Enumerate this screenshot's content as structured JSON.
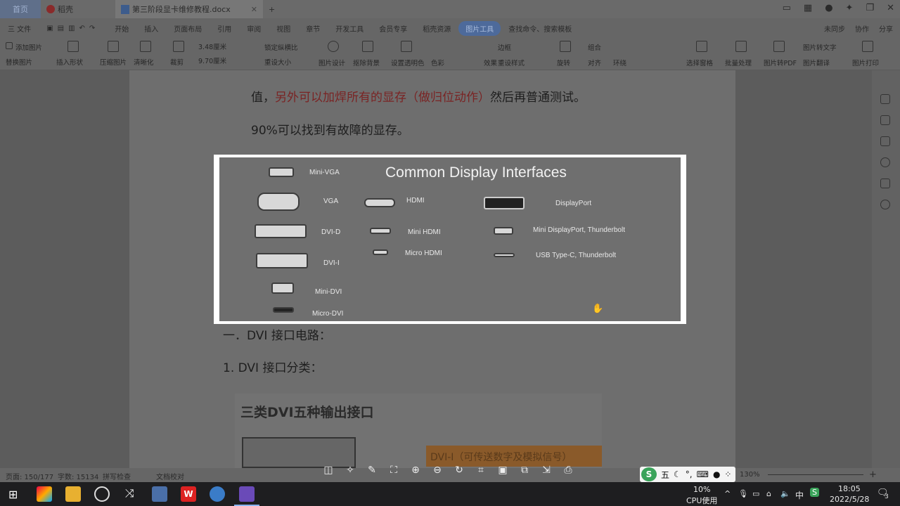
{
  "titlebar": {
    "home_tab": "首页",
    "tab_wps": "稻壳",
    "tab_doc": "第三阶段显卡维修教程.docx",
    "new_tab": "+"
  },
  "menu": {
    "items": [
      "三 文件",
      "开始",
      "插入",
      "页面布局",
      "引用",
      "审阅",
      "视图",
      "章节",
      "开发工具",
      "会员专享",
      "稻壳资源"
    ],
    "selected": "图片工具",
    "search": "查找命令、搜索模板",
    "right": [
      "未同步",
      "协作",
      "分享"
    ]
  },
  "ribbon": {
    "row1": [
      "添加图片",
      "3.48厘米",
      "锁定纵横比",
      "边框",
      "组合",
      "图片转文字"
    ],
    "row2": [
      "替换图片",
      "插入形状",
      "压缩图片",
      "清晰化",
      "裁剪",
      "9.70厘米",
      "重设大小",
      "图片设计",
      "抠除背景",
      "设置透明色",
      "色彩",
      "效果",
      "重设样式",
      "旋转",
      "对齐",
      "环绕",
      "选择窗格",
      "批量处理",
      "图片转PDF",
      "图片翻译",
      "图片打印"
    ]
  },
  "doc": {
    "line1_prefix": "值，",
    "line1_red": "另外可以加焊所有的显存（做归位动作）",
    "line1_suffix": "然后再普通测试。",
    "line2": "90%可以找到有故障的显存。",
    "heading1": "一．DVI 接口电路：",
    "heading2": "1.  DVI 接口分类：",
    "pic_title": "三类DVI五种输出接口",
    "pic_label": "DVI-I（可传送数字及模拟信号）"
  },
  "viewer": {
    "title": "Common Display Interfaces",
    "labels": {
      "mini_vga": "Mini-VGA",
      "vga": "VGA",
      "dvi_d": "DVI-D",
      "dvi_i": "DVI-I",
      "mini_dvi": "Mini-DVI",
      "micro_dvi": "Micro-DVI",
      "hdmi": "HDMI",
      "mini_hdmi": "Mini HDMI",
      "micro_hdmi": "Micro HDMI",
      "displayport": "DisplayPort",
      "mini_dp": "Mini DisplayPort, Thunderbolt",
      "usbc": "USB Type-C, Thunderbolt"
    }
  },
  "statusbar": {
    "page": "页面: 150/177",
    "words": "字数: 15134",
    "spell": "拼写检查",
    "proof": "文档校对",
    "zoom": "130%"
  },
  "ime": {
    "mode": "五"
  },
  "taskbar": {
    "cpu_value": "10%",
    "cpu_label": "CPU使用",
    "lang": "中",
    "time": "18:05",
    "date": "2022/5/28",
    "notif": "3"
  }
}
